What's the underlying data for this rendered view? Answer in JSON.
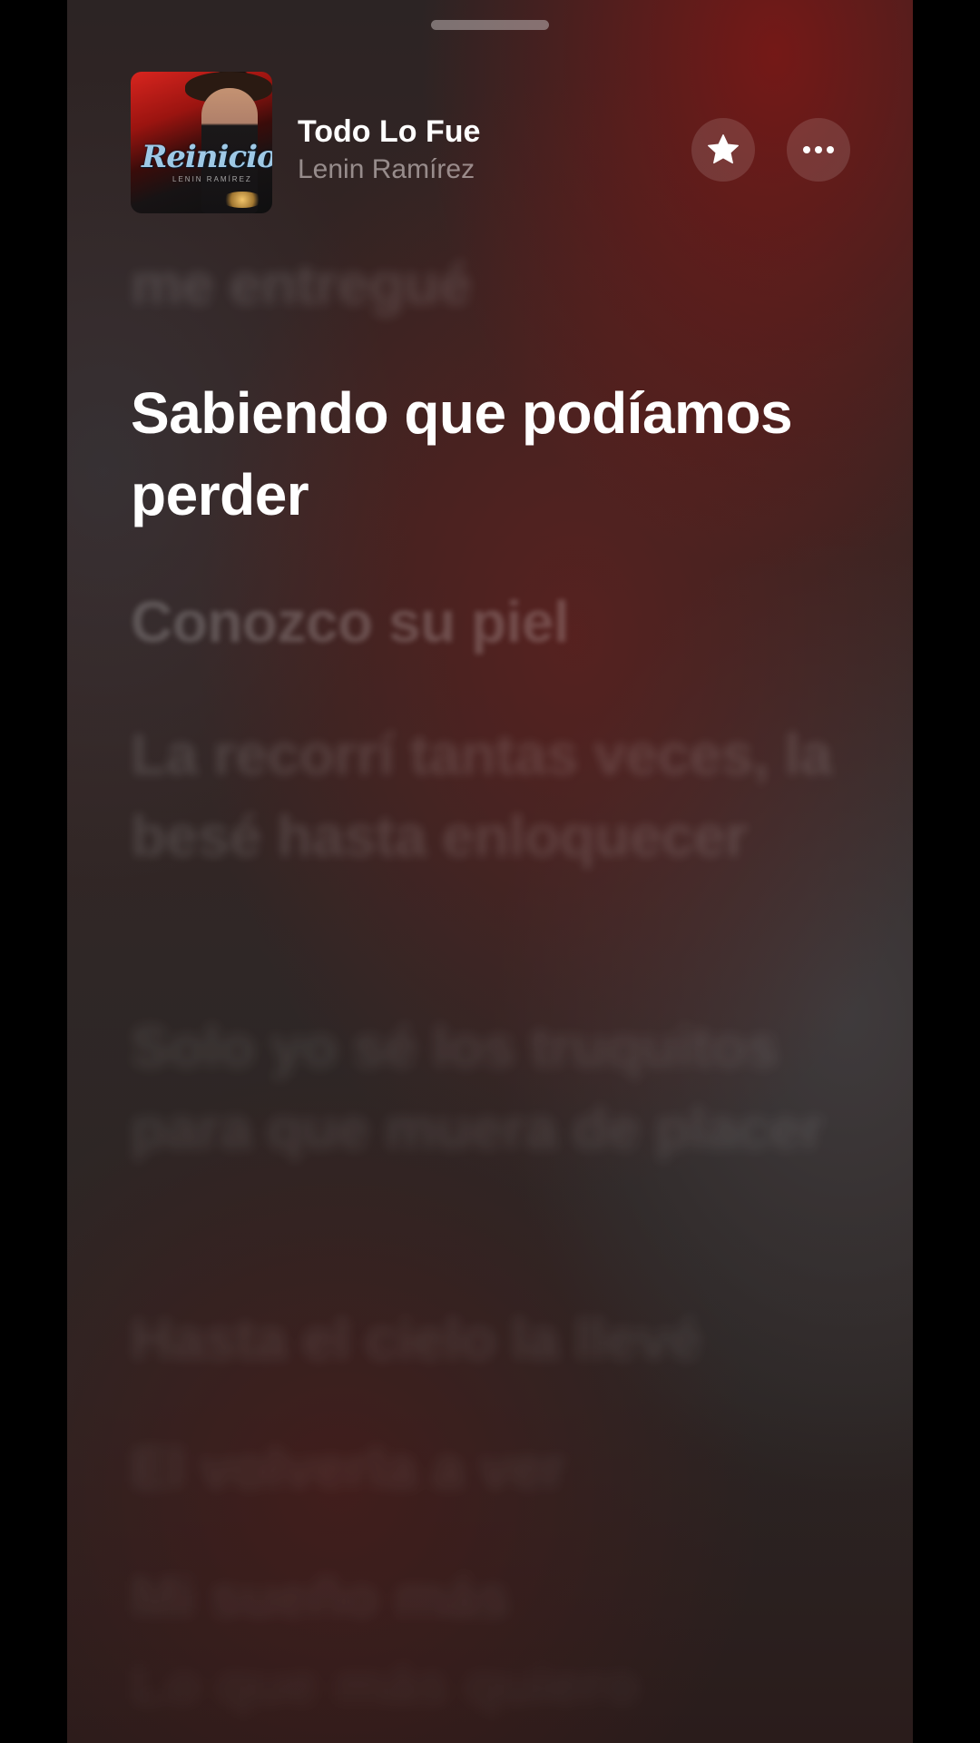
{
  "sheet": {
    "grabber_icon": "grabber-handle"
  },
  "now_playing": {
    "artwork": {
      "title_text": "Reinicio",
      "subtitle_text": "LENIN RAMÍREZ"
    },
    "title": "Todo Lo Fue",
    "artist": "Lenin Ramírez",
    "favorite_icon": "star-icon",
    "more_icon": "ellipsis-icon"
  },
  "lyrics": {
    "previous": "me entregué",
    "current": "Sabiendo que podíamos perder",
    "upcoming": [
      "Conozco su piel",
      "La recorrí tantas veces, la besé hasta enloquecer",
      "Solo yo sé los truquitos para que muera de placer",
      "Hasta el cielo la llevé",
      "El volverla a ver",
      "Mi sueño más",
      "Lo que más quiero"
    ]
  },
  "colors": {
    "accent_red": "#7a1816",
    "background_dark": "#2b2524",
    "lyric_active": "#ffffff"
  }
}
